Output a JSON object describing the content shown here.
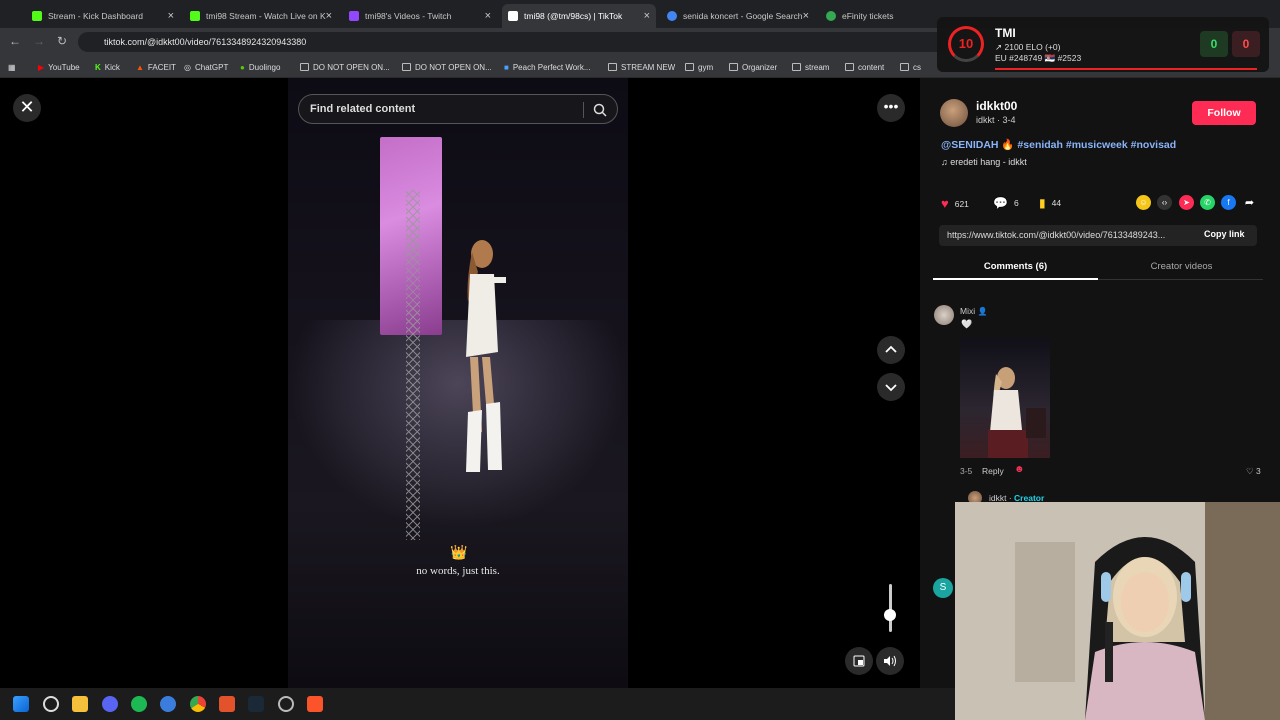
{
  "browser": {
    "tabs": [
      {
        "label": "Stream - Kick Dashboard",
        "color": "#53fc18"
      },
      {
        "label": "tmi98 Stream - Watch Live on K",
        "color": "#53fc18"
      },
      {
        "label": "tmi98's Videos - Twitch",
        "color": "#9146ff"
      },
      {
        "label": "tmi98 (@tm/98cs) | TikTok",
        "color": "#ffffff"
      },
      {
        "label": "senida koncert - Google Search",
        "color": "#4285f4"
      },
      {
        "label": "eFinity tickets",
        "color": "#34a853"
      }
    ],
    "url": "tiktok.com/@idkkt00/video/7613348924320943380",
    "bookmarks": [
      "YouTube",
      "Kick",
      "FACEIT",
      "ChatGPT",
      "Duolingo",
      "DO NOT OPEN ON...",
      "DO NOT OPEN ON...",
      "Peach Perfect Work...",
      "STREAM NEW",
      "gym",
      "Organizer",
      "stream",
      "content",
      "cs"
    ]
  },
  "video": {
    "search_placeholder": "Find related content",
    "caption_emoji": "👑",
    "caption": "no words, just this.",
    "volume_level": 0.35
  },
  "post": {
    "author": "idkkt00",
    "author_sub": "idkkt · 3-4",
    "follow_label": "Follow",
    "mention": "@SENIDAH",
    "fire_emoji": "🔥",
    "hashtags": "#senidah #musicweek #novisad",
    "music": "eredeti hang - idkkt",
    "likes": "621",
    "comments": "6",
    "saves": "44",
    "link": "https://www.tiktok.com/@idkkt00/video/76133489243...",
    "copy_label": "Copy link",
    "tab_comments": "Comments (6)",
    "tab_creator": "Creator videos"
  },
  "comment": {
    "user": "Mixi",
    "text": "🤍",
    "date": "3-5",
    "reply": "Reply",
    "likes": "3",
    "reply_user": "idkkt",
    "reply_badge": "Creator",
    "next_avatar": "S"
  },
  "faceit": {
    "level": "10",
    "name": "TMI",
    "elo": "2100 ELO (+0)",
    "rank": "EU #248749 🇷🇸 #2523",
    "wins": "0",
    "losses": "0"
  },
  "colors": {
    "accent": "#fe2c55",
    "link": "#8ab4f8",
    "creator": "#20d5ec"
  }
}
